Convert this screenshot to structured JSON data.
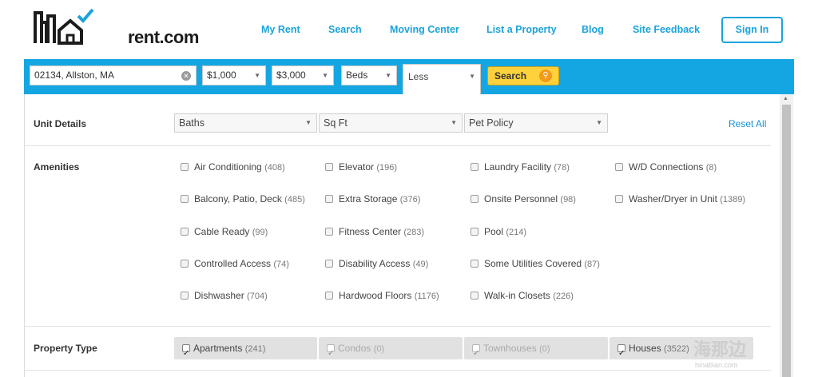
{
  "header": {
    "logo_text": "rent.com",
    "nav": [
      "My Rent",
      "Search",
      "Moving Center",
      "List a Property",
      "Blog",
      "Site Feedback"
    ],
    "sign_in": "Sign In"
  },
  "searchbar": {
    "location": "02134, Allston, MA",
    "min_price": "$1,000",
    "max_price": "$3,000",
    "beds": "Beds",
    "more_less": "Less",
    "search_button": "Search"
  },
  "filters": {
    "unit_details": {
      "label": "Unit Details",
      "baths": "Baths",
      "sqft": "Sq Ft",
      "pet_policy": "Pet Policy",
      "reset": "Reset All"
    },
    "amenities": {
      "label": "Amenities",
      "items": [
        {
          "name": "Air Conditioning",
          "count": "(408)"
        },
        {
          "name": "Elevator",
          "count": "(196)"
        },
        {
          "name": "Laundry Facility",
          "count": "(78)"
        },
        {
          "name": "W/D Connections",
          "count": "(8)"
        },
        {
          "name": "Balcony, Patio, Deck",
          "count": "(485)"
        },
        {
          "name": "Extra Storage",
          "count": "(376)"
        },
        {
          "name": "Onsite Personnel",
          "count": "(98)"
        },
        {
          "name": "Washer/Dryer in Unit",
          "count": "(1389)"
        },
        {
          "name": "Cable Ready",
          "count": "(99)"
        },
        {
          "name": "Fitness Center",
          "count": "(283)"
        },
        {
          "name": "Pool",
          "count": "(214)"
        },
        {
          "name": "Controlled Access",
          "count": "(74)"
        },
        {
          "name": "Disability Access",
          "count": "(49)"
        },
        {
          "name": "Some Utilities Covered",
          "count": "(87)"
        },
        {
          "name": "Dishwasher",
          "count": "(704)"
        },
        {
          "name": "Hardwood Floors",
          "count": "(1176)"
        },
        {
          "name": "Walk-in Closets",
          "count": "(226)"
        }
      ]
    },
    "property_type": {
      "label": "Property Type",
      "items": [
        {
          "name": "Apartments",
          "count": "(241)"
        },
        {
          "name": "Condos",
          "count": "(0)"
        },
        {
          "name": "Townhouses",
          "count": "(0)"
        },
        {
          "name": "Houses",
          "count": "(3522)"
        }
      ]
    }
  },
  "watermark": {
    "text": "海那边",
    "sub": "hinabian.com"
  },
  "colors": {
    "accent": "#14a6e3",
    "nav": "#1aa3dc",
    "search_button": "#ffd23c"
  }
}
